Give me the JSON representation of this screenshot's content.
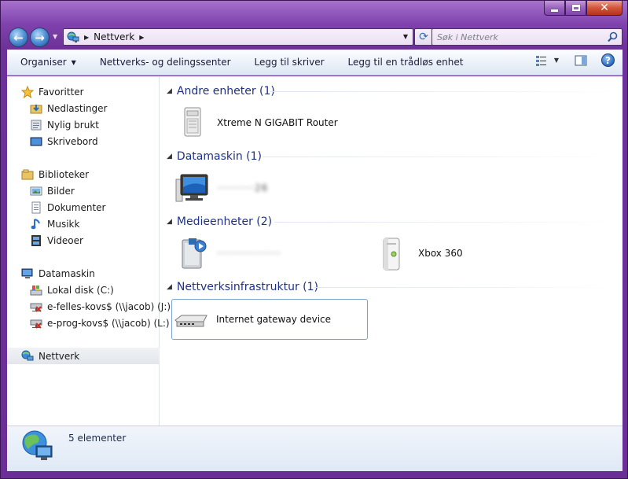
{
  "window": {
    "caption_close": "✕"
  },
  "nav": {
    "back_glyph": "←",
    "forward_glyph": "→",
    "address_segment": "Nettverk",
    "refresh_glyph": "⟳",
    "search_placeholder": "Søk i Nettverk"
  },
  "toolbar": {
    "organize_label": "Organiser",
    "network_sharing_label": "Nettverks- og delingssenter",
    "add_printer_label": "Legg til skriver",
    "add_wireless_label": "Legg til en trådløs enhet",
    "help_glyph": "?"
  },
  "sidebar": {
    "favorites": {
      "label": "Favoritter",
      "items": [
        "Nedlastinger",
        "Nylig brukt",
        "Skrivebord"
      ]
    },
    "libraries": {
      "label": "Biblioteker",
      "items": [
        "Bilder",
        "Dokumenter",
        "Musikk",
        "Videoer"
      ]
    },
    "computer": {
      "label": "Datamaskin",
      "items": [
        "Lokal disk (C:)",
        "e-felles-kovs$ (\\\\jacob) (J:)",
        "e-prog-kovs$ (\\\\jacob) (L:)"
      ]
    },
    "network": {
      "label": "Nettverk"
    }
  },
  "groups": {
    "other_devices": {
      "header": "Andre enheter (1)",
      "items": [
        "Xtreme N GIGABIT Router"
      ]
    },
    "computers": {
      "header": "Datamaskin (1)",
      "items": [
        "··········26"
      ]
    },
    "media": {
      "header": "Medieenheter (2)",
      "items": [
        "·················",
        "Xbox 360"
      ]
    },
    "infrastructure": {
      "header": "Nettverksinfrastruktur (1)",
      "items": [
        "Internet gateway device"
      ]
    }
  },
  "status": {
    "item_count": "5 elementer"
  },
  "colors": {
    "frame_accent": "#7f42ad",
    "group_header": "#1e3287",
    "selection_border": "#7da2ce"
  }
}
